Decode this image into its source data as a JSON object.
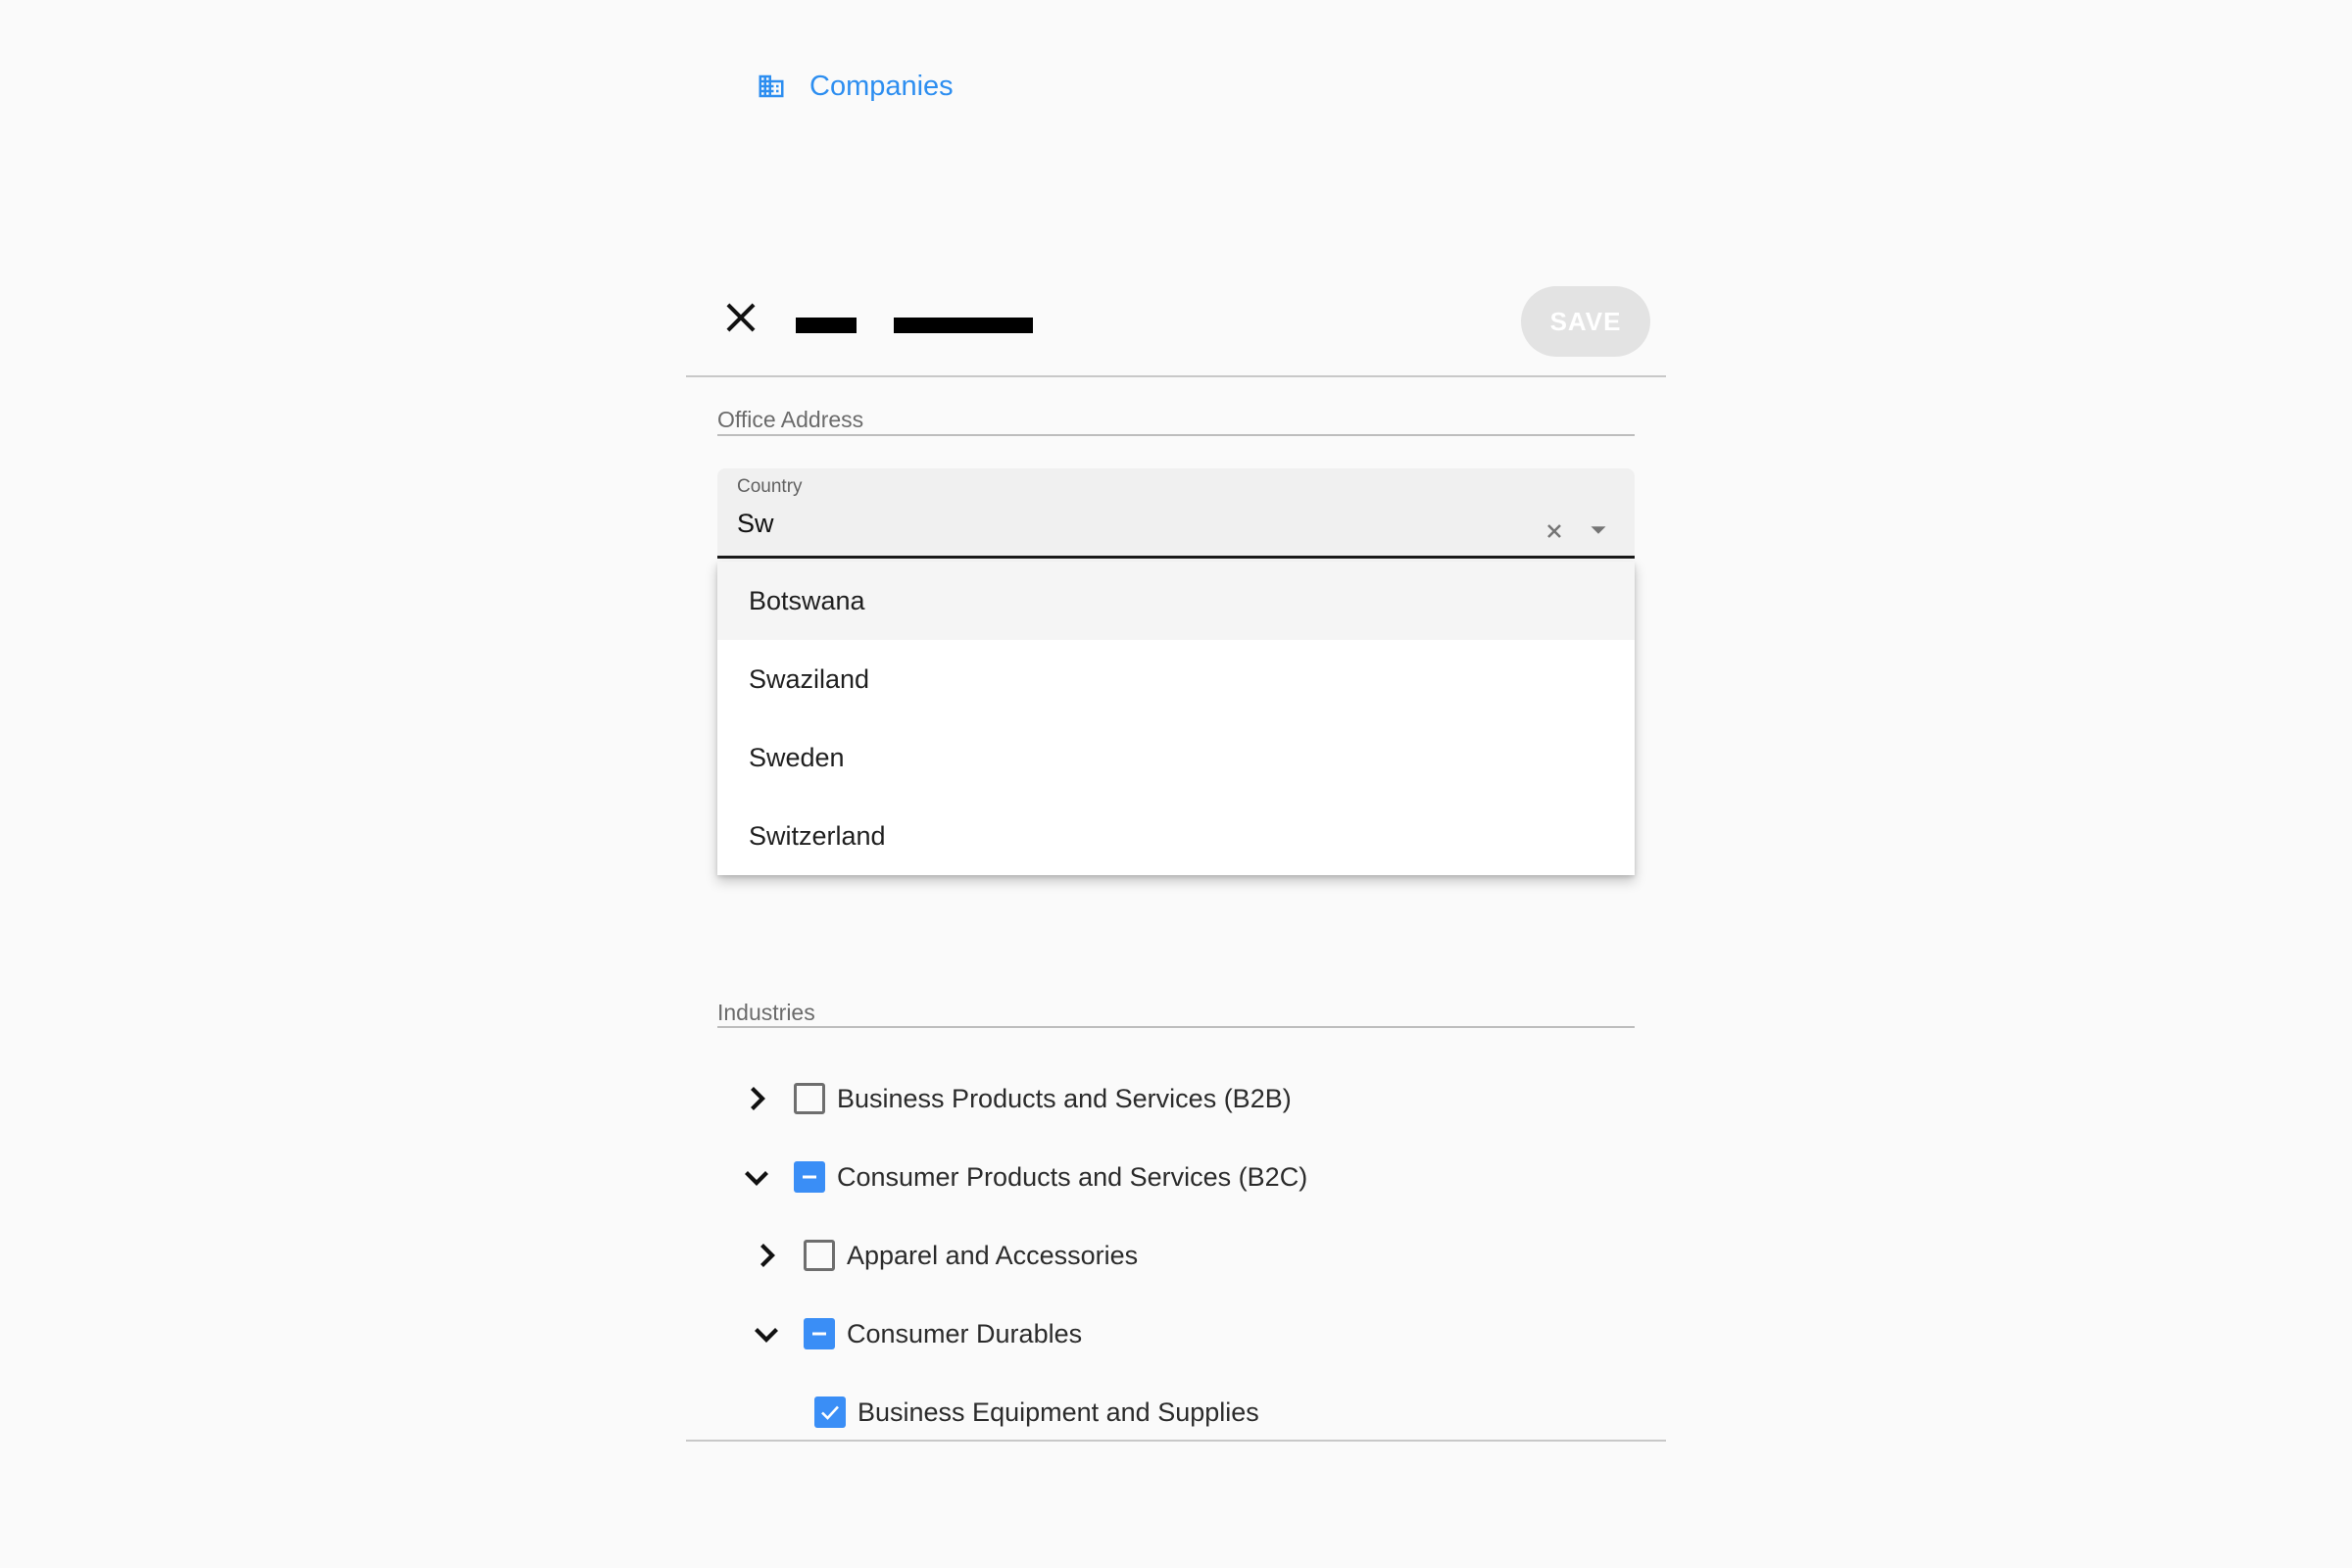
{
  "nav": {
    "label": "Companies",
    "icon": "building-icon",
    "color": "#2d8ef0"
  },
  "header": {
    "save_label": "SAVE",
    "close_icon": "close-icon"
  },
  "sections": {
    "office_address": "Office Address",
    "industries": "Industries"
  },
  "country": {
    "label": "Country",
    "value": "Sw",
    "options": [
      "Botswana",
      "Swaziland",
      "Sweden",
      "Switzerland"
    ],
    "highlighted": "Botswana"
  },
  "industries": [
    {
      "label": "Business Products and Services (B2B)",
      "expanded": false,
      "state": "unchecked",
      "level": 0
    },
    {
      "label": "Consumer Products and Services (B2C)",
      "expanded": true,
      "state": "indeterminate",
      "level": 0
    },
    {
      "label": "Apparel and Accessories",
      "expanded": false,
      "state": "unchecked",
      "level": 1
    },
    {
      "label": "Consumer Durables",
      "expanded": true,
      "state": "indeterminate",
      "level": 1
    },
    {
      "label": "Business Equipment and Supplies",
      "expanded": null,
      "state": "checked",
      "level": 2
    }
  ],
  "colors": {
    "accent": "#3a8ef6",
    "background": "#fafafa"
  }
}
